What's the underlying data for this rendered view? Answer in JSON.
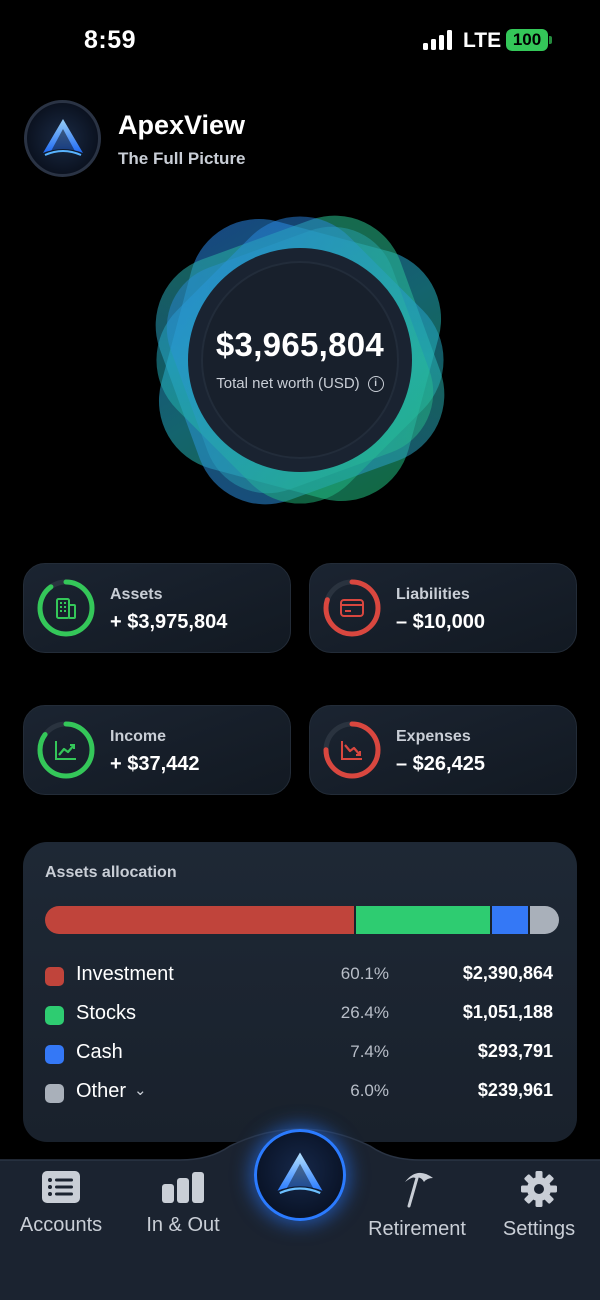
{
  "status_bar": {
    "time": "8:59",
    "network": "LTE",
    "battery": "100",
    "icons": [
      "signal-icon",
      "battery-icon"
    ]
  },
  "header": {
    "title": "ApexView",
    "subtitle": "The Full Picture",
    "logo_icon": "apex-logo-icon"
  },
  "net_worth": {
    "value": "$3,965,804",
    "label": "Total net worth (USD)",
    "info_icon": "info-icon"
  },
  "cards": {
    "assets": {
      "label": "Assets",
      "value": "+ $3,975,804",
      "icon": "building-icon",
      "color": "#34c759",
      "ring_fraction": 0.9
    },
    "liabilities": {
      "label": "Liabilities",
      "value": "– $10,000",
      "icon": "credit-card-icon",
      "color": "#d9473f",
      "ring_fraction": 0.8
    },
    "income": {
      "label": "Income",
      "value": "+ $37,442",
      "icon": "trend-up-icon",
      "color": "#34c759",
      "ring_fraction": 0.85
    },
    "expenses": {
      "label": "Expenses",
      "value": "– $26,425",
      "icon": "trend-down-icon",
      "color": "#d9473f",
      "ring_fraction": 0.75
    }
  },
  "allocation": {
    "title": "Assets allocation",
    "items": [
      {
        "name": "Investment",
        "percent": "60.1%",
        "amount": "$2,390,864",
        "fraction": 0.601,
        "color": "#c0443b"
      },
      {
        "name": "Stocks",
        "percent": "26.4%",
        "amount": "$1,051,188",
        "fraction": 0.264,
        "color": "#2ecc71"
      },
      {
        "name": "Cash",
        "percent": "7.4%",
        "amount": "$293,791",
        "fraction": 0.074,
        "color": "#3478f6"
      },
      {
        "name": "Other",
        "percent": "6.0%",
        "amount": "$239,961",
        "fraction": 0.06,
        "color": "#a9b0ba"
      }
    ]
  },
  "tabs": {
    "accounts": "Accounts",
    "in_out": "In & Out",
    "retirement": "Retirement",
    "settings": "Settings"
  },
  "colors": {
    "accent_blue": "#2b7bff",
    "positive": "#34c759",
    "negative": "#d9473f"
  }
}
